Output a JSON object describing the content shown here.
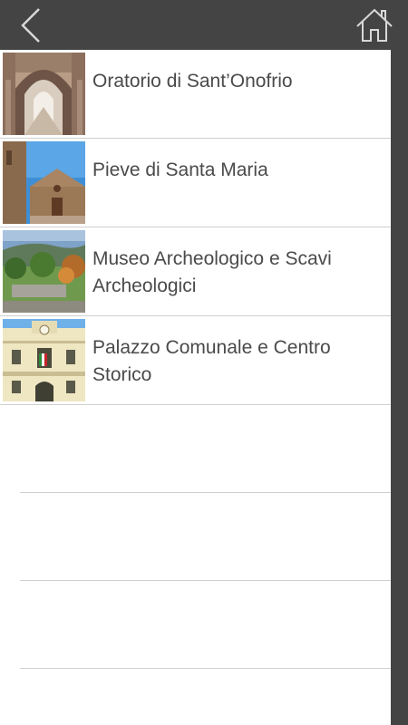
{
  "header": {
    "back_icon": "chevron-left-icon",
    "home_icon": "home-icon"
  },
  "list": {
    "items": [
      {
        "label": "Oratorio di Sant’Onofrio",
        "thumb": "arcade-photo"
      },
      {
        "label": "Pieve di Santa Maria",
        "thumb": "church-photo"
      },
      {
        "label": "Museo Archeologico e Scavi Archeologici",
        "thumb": "park-photo"
      },
      {
        "label": "Palazzo Comunale e Centro Storico",
        "thumb": "townhall-photo"
      }
    ]
  },
  "colors": {
    "bar": "#444444",
    "background": "#ffffff",
    "separator": "#cfcfcf",
    "text": "#4a4a4a"
  }
}
